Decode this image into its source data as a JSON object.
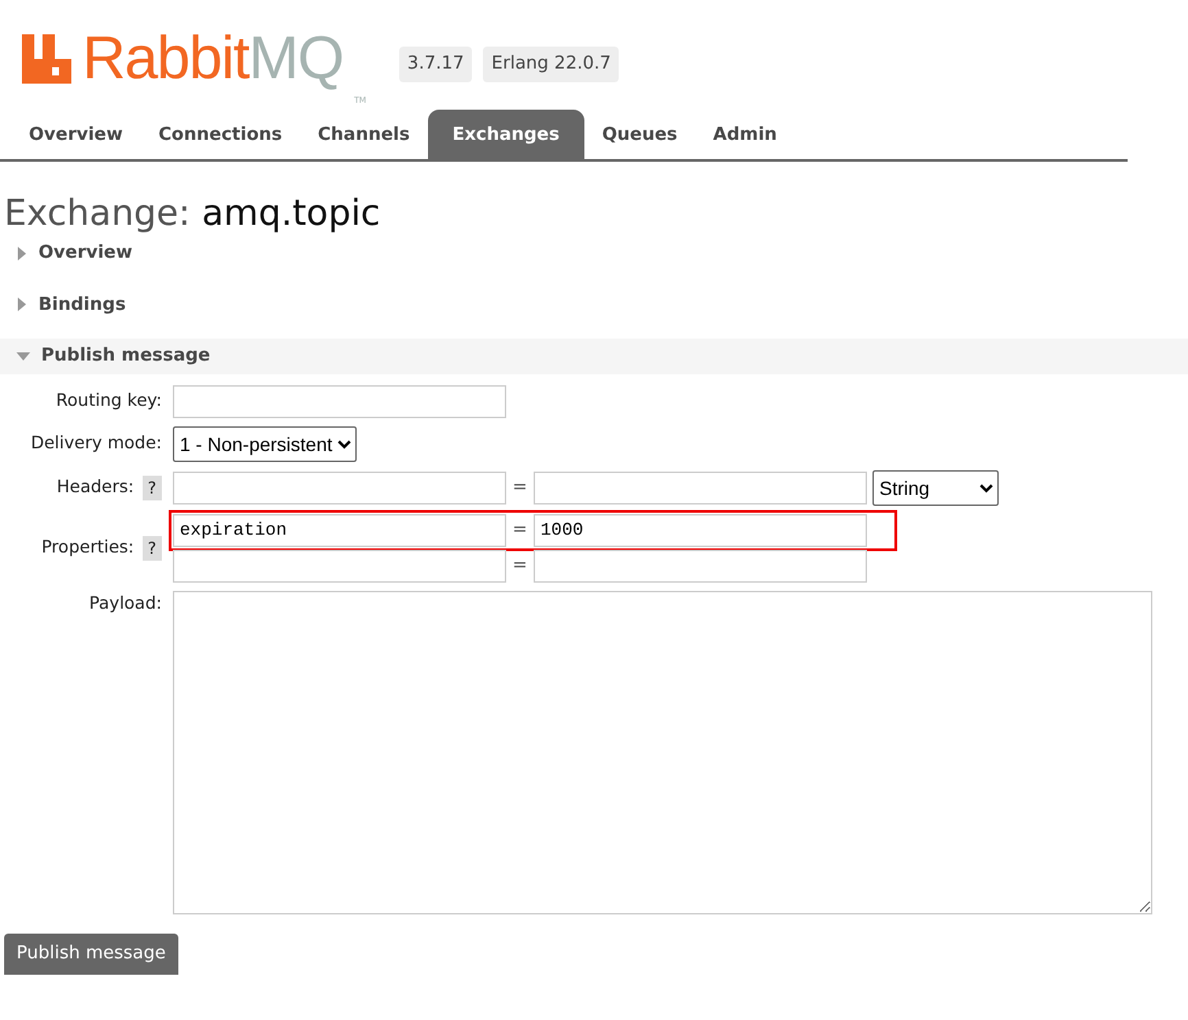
{
  "logo": {
    "primary": "Rabbit",
    "secondary": "MQ",
    "trademark": "TM"
  },
  "badges": [
    "3.7.17",
    "Erlang 22.0.7"
  ],
  "tabs": [
    {
      "label": "Overview",
      "selected": false
    },
    {
      "label": "Connections",
      "selected": false
    },
    {
      "label": "Channels",
      "selected": false
    },
    {
      "label": "Exchanges",
      "selected": true
    },
    {
      "label": "Queues",
      "selected": false
    },
    {
      "label": "Admin",
      "selected": false
    }
  ],
  "title": {
    "prefix": "Exchange:",
    "name": "amq.topic"
  },
  "sections": [
    {
      "label": "Overview",
      "expanded": false
    },
    {
      "label": "Bindings",
      "expanded": false
    },
    {
      "label": "Publish message",
      "expanded": true
    }
  ],
  "form": {
    "routing_key": {
      "label": "Routing key:"
    },
    "delivery_mode": {
      "label": "Delivery mode:",
      "value": "1 - Non-persistent"
    },
    "headers": {
      "label": "Headers:",
      "help": "?",
      "equals": "=",
      "type": "String"
    },
    "properties": {
      "label": "Properties:",
      "help": "?",
      "rows": [
        {
          "key": "expiration",
          "equals": "=",
          "value": "1000",
          "highlighted": true
        },
        {
          "equals": "=",
          "highlighted": false
        }
      ]
    },
    "payload": {
      "label": "Payload:"
    },
    "submit": "Publish message"
  }
}
